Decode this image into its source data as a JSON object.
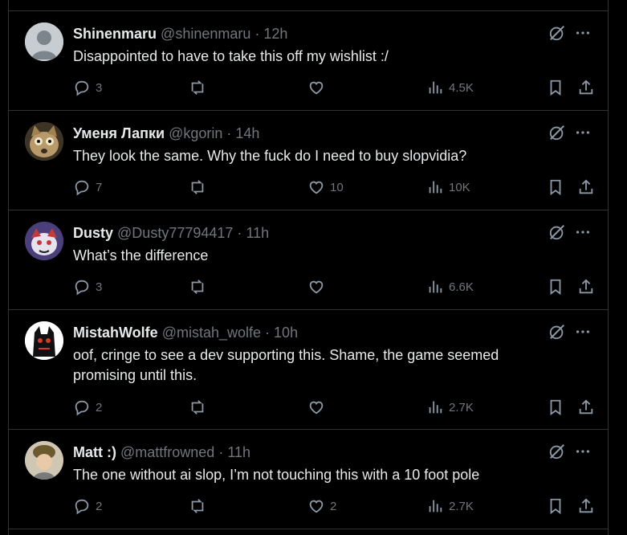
{
  "posts": [
    {
      "name": "Shinenmaru",
      "handle": "@shinenmaru",
      "time": "12h",
      "text": "Disappointed to have to take this off my wishlist :/",
      "replies": "3",
      "reposts": "",
      "likes": "",
      "views": "4.5K",
      "avatar_color": "#c8cdd2"
    },
    {
      "name": "Уменя Лапки",
      "handle": "@kgorin",
      "time": "14h",
      "text": "They look the same. Why the fuck do I need to buy slopvidia?",
      "replies": "7",
      "reposts": "",
      "likes": "10",
      "views": "10K",
      "avatar_color": "#6b5a3a"
    },
    {
      "name": "Dusty",
      "handle": "@Dusty77794417",
      "time": "11h",
      "text": "What’s the difference",
      "replies": "3",
      "reposts": "",
      "likes": "",
      "views": "6.6K",
      "avatar_color": "#5a4d8c"
    },
    {
      "name": "MistahWolfe",
      "handle": "@mistah_wolfe",
      "time": "10h",
      "text": "oof, cringe to see a dev supporting this. Shame, the game seemed promising until this.",
      "replies": "2",
      "reposts": "",
      "likes": "",
      "views": "2.7K",
      "avatar_color": "#ffffff"
    },
    {
      "name": "Matt :)",
      "handle": "@mattfrowned",
      "time": "11h",
      "text": "The one without ai slop, I’m not touching this with a 10 foot pole",
      "replies": "2",
      "reposts": "",
      "likes": "2",
      "views": "2.7K",
      "avatar_color": "#8a7a55"
    }
  ],
  "separator": "·",
  "colors": {
    "background": "#000000",
    "text": "#e7e9ea",
    "muted": "#71767b",
    "border": "#2f3336"
  },
  "icons": [
    "reply-icon",
    "repost-icon",
    "like-icon",
    "views-icon",
    "bookmark-icon",
    "share-icon",
    "grok-icon",
    "more-icon"
  ]
}
